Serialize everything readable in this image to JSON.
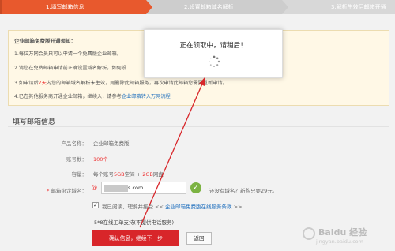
{
  "steps": [
    {
      "label": "1.填写邮箱信息"
    },
    {
      "label": "2.设置邮箱域名解析"
    },
    {
      "label": "3.解析生效后邮箱开通"
    }
  ],
  "notice": {
    "title": "企业邮箱免费版开通须知：",
    "lines": [
      "1.每位万网会员只可以申请一个免费版企业邮箱。",
      "2.请您在免费邮箱申请前正确设置域名解析，如何设",
      "3.如申请后",
      "7天",
      "内您的邮箱域名解析未生效，则删除此邮箱服务，再次申请此邮箱您需要重新申请。",
      "4.已在其他服务商开通企业邮箱，继续入，请参考",
      "企业邮箱转入万网流程"
    ]
  },
  "modal": {
    "message": "正在领取中，请稍后！"
  },
  "form": {
    "title": "填写邮箱信息",
    "product_label": "产品名称：",
    "product_value": "企业邮箱免费版",
    "accounts_label": "账号数：",
    "accounts_value": "100个",
    "capacity_label": "容量：",
    "capacity_prefix": "每个账号",
    "capacity_mail": "5GB",
    "capacity_mid": "空间 + ",
    "capacity_disk": "2GB",
    "capacity_suffix": "网盘",
    "domain_required": "*",
    "domain_label": "邮箱绑定域名：",
    "domain_at": "@",
    "domain_suffix": "s.com",
    "domain_hint": "还没有域名？新购只要29元。",
    "agree_text": "我已阅读，理解并接受 <<",
    "agree_link": "企业邮箱免费版在线服务条款",
    "agree_close": ">>",
    "support_text": "5*8在线工单支持(不提供电话服务)",
    "primary_button": "确认信息，继续下一步",
    "back_button": "返回"
  },
  "watermark": {
    "brand": "Baidu 经验",
    "url": "jingyan.baidu.com"
  },
  "colors": {
    "active_step": "#e8592d",
    "primary_button": "#d8262a",
    "link": "#1c6dbd",
    "check_ok": "#7cb342"
  }
}
